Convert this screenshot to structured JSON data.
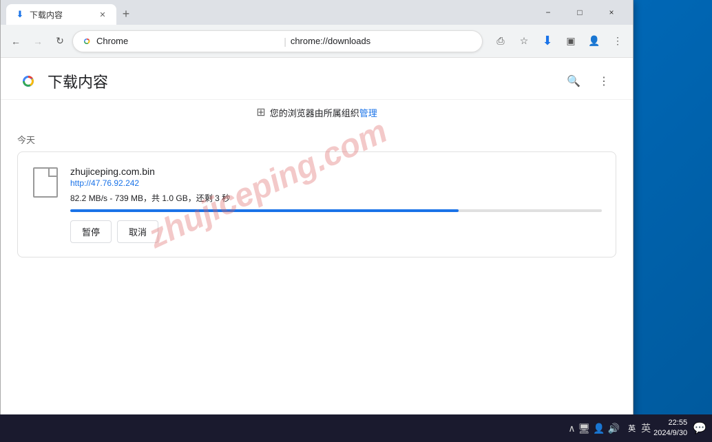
{
  "desktop": {
    "background": "#0078d4"
  },
  "window": {
    "title": "下载内容"
  },
  "tab": {
    "title": "下载内容",
    "favicon": "⬇"
  },
  "addressbar": {
    "back_disabled": false,
    "forward_disabled": true,
    "url": "chrome://downloads",
    "chrome_label": "Chrome",
    "separator": "|"
  },
  "page": {
    "title": "下载内容",
    "managed_text": "您的浏览器由所属组织管理"
  },
  "today": {
    "label": "今天"
  },
  "download": {
    "filename": "zhujiceping.com.bin",
    "url": "http://47.76.92.242",
    "status": "82.2 MB/s - 739 MB，共 1.0 GB，还剩 3 秒",
    "progress_percent": 73,
    "pause_label": "暂停",
    "cancel_label": "取消"
  },
  "watermark": {
    "text": "zhujiceping.com"
  },
  "taskbar": {
    "time": "22:55",
    "date": "2024/9/30",
    "lang": "英",
    "notification_icon": "💬"
  },
  "window_controls": {
    "minimize": "−",
    "maximize": "□",
    "close": "×"
  }
}
